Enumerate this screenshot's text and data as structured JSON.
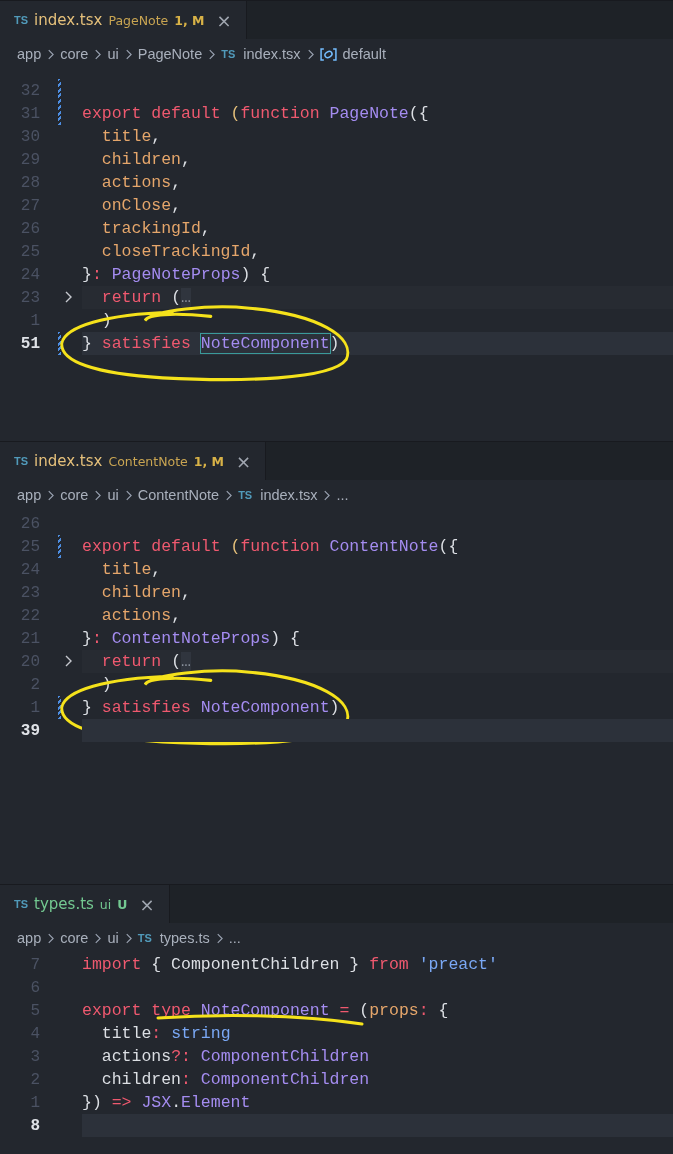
{
  "panes": [
    {
      "tab": {
        "icon": "TS",
        "filename": "index.tsx",
        "folder": "PageNote",
        "badge": "1, M",
        "kind": "modified",
        "close": "×"
      },
      "breadcrumb": [
        {
          "kind": "folder",
          "text": "app"
        },
        {
          "kind": "folder",
          "text": "core"
        },
        {
          "kind": "folder",
          "text": "ui"
        },
        {
          "kind": "folder",
          "text": "PageNote"
        },
        {
          "kind": "file",
          "icon": "TS",
          "text": "index.tsx"
        },
        {
          "kind": "symbol",
          "text": "default"
        }
      ],
      "lines": [
        {
          "num": "32",
          "current": false,
          "modified": true
        },
        {
          "num": "31",
          "current": false,
          "modified": true,
          "tokens": [
            {
              "kind": "kw",
              "t": "export default "
            },
            {
              "kind": "paren",
              "t": "("
            },
            {
              "kind": "kw",
              "t": "function "
            },
            {
              "kind": "type",
              "t": "PageNote"
            },
            {
              "kind": "plain",
              "t": "({"
            }
          ]
        },
        {
          "num": "30",
          "current": false,
          "modified": false,
          "tokens": [
            {
              "kind": "param",
              "t": "  title"
            },
            {
              "kind": "plain",
              "t": ","
            }
          ]
        },
        {
          "num": "29",
          "current": false,
          "modified": false,
          "tokens": [
            {
              "kind": "param",
              "t": "  children"
            },
            {
              "kind": "plain",
              "t": ","
            }
          ]
        },
        {
          "num": "28",
          "current": false,
          "modified": false,
          "tokens": [
            {
              "kind": "param",
              "t": "  actions"
            },
            {
              "kind": "plain",
              "t": ","
            }
          ]
        },
        {
          "num": "27",
          "current": false,
          "modified": false,
          "tokens": [
            {
              "kind": "param",
              "t": "  onClose"
            },
            {
              "kind": "plain",
              "t": ","
            }
          ]
        },
        {
          "num": "26",
          "current": false,
          "modified": false,
          "tokens": [
            {
              "kind": "param",
              "t": "  trackingId"
            },
            {
              "kind": "plain",
              "t": ","
            }
          ]
        },
        {
          "num": "25",
          "current": false,
          "modified": false,
          "tokens": [
            {
              "kind": "param",
              "t": "  closeTrackingId"
            },
            {
              "kind": "plain",
              "t": ","
            }
          ]
        },
        {
          "num": "24",
          "current": false,
          "modified": false,
          "tokens": [
            {
              "kind": "plain",
              "t": "}"
            },
            {
              "kind": "kw",
              "t": ": "
            },
            {
              "kind": "type",
              "t": "PageNoteProps"
            },
            {
              "kind": "plain",
              "t": ") {"
            }
          ]
        },
        {
          "num": "23",
          "current": false,
          "modified": false,
          "folded": true,
          "tokens": [
            {
              "kind": "kw",
              "t": "  return "
            },
            {
              "kind": "plain",
              "t": "("
            },
            {
              "kind": "fold",
              "t": "…"
            }
          ]
        },
        {
          "num": "1",
          "current": false,
          "modified": false,
          "tokens": [
            {
              "kind": "plain",
              "t": "  )"
            }
          ]
        },
        {
          "num": "51",
          "current": true,
          "modified": true,
          "annotation": {
            "kind": "circle"
          },
          "tokens": [
            {
              "kind": "plain",
              "t": "} "
            },
            {
              "kind": "kw",
              "t": "satisfies "
            },
            {
              "kind": "match",
              "t": "NoteComponent"
            },
            {
              "kind": "plain",
              "t": ")"
            }
          ]
        }
      ]
    },
    {
      "tab": {
        "icon": "TS",
        "filename": "index.tsx",
        "folder": "ContentNote",
        "badge": "1, M",
        "kind": "modified",
        "close": "×"
      },
      "breadcrumb": [
        {
          "kind": "folder",
          "text": "app"
        },
        {
          "kind": "folder",
          "text": "core"
        },
        {
          "kind": "folder",
          "text": "ui"
        },
        {
          "kind": "folder",
          "text": "ContentNote"
        },
        {
          "kind": "file",
          "icon": "TS",
          "text": "index.tsx"
        },
        {
          "kind": "more",
          "text": "..."
        }
      ],
      "lines": [
        {
          "num": "26",
          "current": false,
          "modified": false
        },
        {
          "num": "25",
          "current": false,
          "modified": true,
          "tokens": [
            {
              "kind": "kw",
              "t": "export default "
            },
            {
              "kind": "paren",
              "t": "("
            },
            {
              "kind": "kw",
              "t": "function "
            },
            {
              "kind": "type",
              "t": "ContentNote"
            },
            {
              "kind": "plain",
              "t": "({"
            }
          ]
        },
        {
          "num": "24",
          "current": false,
          "modified": false,
          "tokens": [
            {
              "kind": "param",
              "t": "  title"
            },
            {
              "kind": "plain",
              "t": ","
            }
          ]
        },
        {
          "num": "23",
          "current": false,
          "modified": false,
          "tokens": [
            {
              "kind": "param",
              "t": "  children"
            },
            {
              "kind": "plain",
              "t": ","
            }
          ]
        },
        {
          "num": "22",
          "current": false,
          "modified": false,
          "tokens": [
            {
              "kind": "param",
              "t": "  actions"
            },
            {
              "kind": "plain",
              "t": ","
            }
          ]
        },
        {
          "num": "21",
          "current": false,
          "modified": false,
          "tokens": [
            {
              "kind": "plain",
              "t": "}"
            },
            {
              "kind": "kw",
              "t": ": "
            },
            {
              "kind": "type",
              "t": "ContentNoteProps"
            },
            {
              "kind": "plain",
              "t": ") {"
            }
          ]
        },
        {
          "num": "20",
          "current": false,
          "modified": false,
          "folded": true,
          "tokens": [
            {
              "kind": "kw",
              "t": "  return "
            },
            {
              "kind": "plain",
              "t": "("
            },
            {
              "kind": "fold",
              "t": "…"
            }
          ]
        },
        {
          "num": "2",
          "current": false,
          "modified": false,
          "tokens": [
            {
              "kind": "plain",
              "t": "  )"
            }
          ]
        },
        {
          "num": "1",
          "current": false,
          "modified": true,
          "annotation": {
            "kind": "circle"
          },
          "tokens": [
            {
              "kind": "plain",
              "t": "} "
            },
            {
              "kind": "kw",
              "t": "satisfies "
            },
            {
              "kind": "type",
              "t": "NoteComponent"
            },
            {
              "kind": "plain",
              "t": ")"
            }
          ]
        },
        {
          "num": "39",
          "current": true,
          "modified": false
        }
      ]
    },
    {
      "tab": {
        "icon": "TS",
        "filename": "types.ts",
        "folder": "ui",
        "badge": "U",
        "kind": "untracked",
        "close": "×"
      },
      "breadcrumb": [
        {
          "kind": "folder",
          "text": "app"
        },
        {
          "kind": "folder",
          "text": "core"
        },
        {
          "kind": "folder",
          "text": "ui"
        },
        {
          "kind": "file",
          "icon": "TS",
          "text": "types.ts"
        },
        {
          "kind": "more",
          "text": "..."
        }
      ],
      "lines": [
        {
          "num": "7",
          "current": false,
          "modified": false,
          "tokens": [
            {
              "kind": "kw",
              "t": "import "
            },
            {
              "kind": "plain",
              "t": "{ ComponentChildren } "
            },
            {
              "kind": "kw",
              "t": "from "
            },
            {
              "kind": "string",
              "t": "'preact'"
            }
          ]
        },
        {
          "num": "6",
          "current": false,
          "modified": false
        },
        {
          "num": "5",
          "current": false,
          "modified": false,
          "annotation": {
            "kind": "underline"
          },
          "tokens": [
            {
              "kind": "kw",
              "t": "export type "
            },
            {
              "kind": "type",
              "t": "NoteComponent "
            },
            {
              "kind": "kw",
              "t": "= "
            },
            {
              "kind": "plain",
              "t": "("
            },
            {
              "kind": "param",
              "t": "props"
            },
            {
              "kind": "kw",
              "t": ": "
            },
            {
              "kind": "plain",
              "t": "{"
            }
          ]
        },
        {
          "num": "4",
          "current": false,
          "modified": false,
          "tokens": [
            {
              "kind": "plain",
              "t": "  title"
            },
            {
              "kind": "kw",
              "t": ": "
            },
            {
              "kind": "string",
              "t": "string"
            }
          ]
        },
        {
          "num": "3",
          "current": false,
          "modified": false,
          "tokens": [
            {
              "kind": "plain",
              "t": "  actions"
            },
            {
              "kind": "kw",
              "t": "?: "
            },
            {
              "kind": "type",
              "t": "ComponentChildren"
            }
          ]
        },
        {
          "num": "2",
          "current": false,
          "modified": false,
          "tokens": [
            {
              "kind": "plain",
              "t": "  children"
            },
            {
              "kind": "kw",
              "t": ": "
            },
            {
              "kind": "type",
              "t": "ComponentChildren"
            }
          ]
        },
        {
          "num": "1",
          "current": false,
          "modified": false,
          "tokens": [
            {
              "kind": "plain",
              "t": "})"
            },
            {
              "kind": "kw",
              "t": " => "
            },
            {
              "kind": "type",
              "t": "JSX"
            },
            {
              "kind": "plain",
              "t": "."
            },
            {
              "kind": "type",
              "t": "Element"
            }
          ]
        },
        {
          "num": "8",
          "current": true,
          "modified": false
        }
      ]
    }
  ]
}
